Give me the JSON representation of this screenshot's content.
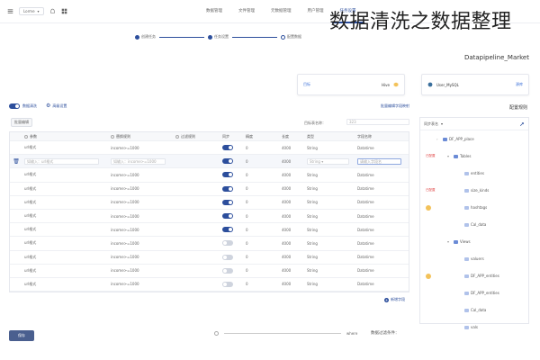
{
  "overlay_title": "数据清洗之数据整理",
  "header": {
    "env_select": "Lorme",
    "nav": [
      {
        "label": "数据管理",
        "active": false
      },
      {
        "label": "文件管理",
        "active": false
      },
      {
        "label": "元数据管理",
        "active": false
      },
      {
        "label": "用户管理",
        "active": false
      },
      {
        "label": "",
        "active": false
      },
      {
        "label": "任务设置",
        "active": true
      }
    ]
  },
  "steps": [
    {
      "label": "创建任务",
      "current": false
    },
    {
      "label": "任务设置",
      "current": false
    },
    {
      "label": "配置数据",
      "current": true
    }
  ],
  "pipeline_title": "Datapipeline_Market",
  "target_card": {
    "tag": "目标",
    "name": "Hive"
  },
  "source_card": {
    "name": "User_MySQL",
    "tag": "源库"
  },
  "section_title": "配置规则",
  "toolbar": {
    "toggle_label": "数据清洗",
    "advanced": "高级设置",
    "batch_edit": "批量编辑字段映射"
  },
  "batch": {
    "label": "目标表名称",
    "btn": "批量编辑"
  },
  "target_table": {
    "label": "目标表名称：",
    "value": "323"
  },
  "table": {
    "headers": {
      "field": "字段名称",
      "type": "类型",
      "len": "长度",
      "inc": "精度",
      "sync": "同步",
      "filter": "过滤规则",
      "cond": "替换规则",
      "param": "参数"
    },
    "rows": [
      {
        "field": "Datatime",
        "type": "String",
        "len": "4000",
        "inc": "0",
        "on": true,
        "filter": "",
        "cond": "income>=1000",
        "param": "url格式",
        "active": false
      },
      {
        "field": "请输入字段名",
        "type": "String",
        "len": "4000",
        "inc": "0",
        "on": true,
        "filter": "",
        "cond": "如输入：income>=1000",
        "param": "如输入：url格式",
        "active": true,
        "editable": true
      },
      {
        "field": "Datatime",
        "type": "String",
        "len": "4000",
        "inc": "0",
        "on": true,
        "filter": "",
        "cond": "income>=1000",
        "param": "url格式",
        "active": false
      },
      {
        "field": "Datatime",
        "type": "String",
        "len": "4000",
        "inc": "0",
        "on": true,
        "filter": "",
        "cond": "income>=1000",
        "param": "url格式",
        "active": false
      },
      {
        "field": "Datatime",
        "type": "String",
        "len": "4000",
        "inc": "0",
        "on": true,
        "filter": "",
        "cond": "income>=1000",
        "param": "url格式",
        "active": false
      },
      {
        "field": "Datatime",
        "type": "String",
        "len": "4000",
        "inc": "0",
        "on": true,
        "filter": "",
        "cond": "income>=1000",
        "param": "url格式",
        "active": false
      },
      {
        "field": "Datatime",
        "type": "String",
        "len": "4000",
        "inc": "0",
        "on": true,
        "filter": "",
        "cond": "income>=1000",
        "param": "url格式",
        "active": false
      },
      {
        "field": "Datatime",
        "type": "String",
        "len": "4000",
        "inc": "0",
        "on": false,
        "filter": "",
        "cond": "income>=1000",
        "param": "url格式",
        "active": false
      },
      {
        "field": "Datatime",
        "type": "String",
        "len": "4000",
        "inc": "0",
        "on": false,
        "filter": "",
        "cond": "income>=1000",
        "param": "url格式",
        "active": false
      },
      {
        "field": "Datatime",
        "type": "String",
        "len": "4000",
        "inc": "0",
        "on": false,
        "filter": "",
        "cond": "income>=1000",
        "param": "url格式",
        "active": false
      },
      {
        "field": "Datatime",
        "type": "String",
        "len": "4000",
        "inc": "0",
        "on": false,
        "filter": "",
        "cond": "income>=1000",
        "param": "url格式",
        "active": false
      }
    ],
    "add_field": "新增字段"
  },
  "tree": {
    "header": "同步表名",
    "items": [
      {
        "label": "DF_APP_place",
        "level": 1,
        "arrow": "›",
        "light": false,
        "marker": ""
      },
      {
        "label": "Tables",
        "level": 2,
        "arrow": "▾",
        "light": false,
        "marker": "red",
        "marker_text": "已配置"
      },
      {
        "label": "entities",
        "level": 3,
        "arrow": "",
        "light": true,
        "marker": ""
      },
      {
        "label": "size_kinds",
        "level": 3,
        "arrow": "",
        "light": true,
        "marker": "red",
        "marker_text": "已配置"
      },
      {
        "label": "hashtags",
        "level": 3,
        "arrow": "",
        "light": true,
        "marker": "warn"
      },
      {
        "label": "Cal_data",
        "level": 3,
        "arrow": "",
        "light": true,
        "marker": ""
      },
      {
        "label": "Views",
        "level": 2,
        "arrow": "▾",
        "light": false,
        "marker": ""
      },
      {
        "label": "valuers",
        "level": 3,
        "arrow": "",
        "light": true,
        "marker": ""
      },
      {
        "label": "DF_APP_entities",
        "level": 3,
        "arrow": "",
        "light": true,
        "marker": "warn"
      },
      {
        "label": "DF_APP_entities",
        "level": 3,
        "arrow": "",
        "light": true,
        "marker": ""
      },
      {
        "label": "Cal_data",
        "level": 3,
        "arrow": "",
        "light": true,
        "marker": ""
      },
      {
        "label": "vals",
        "level": 3,
        "arrow": "",
        "light": true,
        "marker": ""
      }
    ]
  },
  "bottom": {
    "save": "保存",
    "where_label": "where",
    "filter_label": "数据过滤条件："
  }
}
